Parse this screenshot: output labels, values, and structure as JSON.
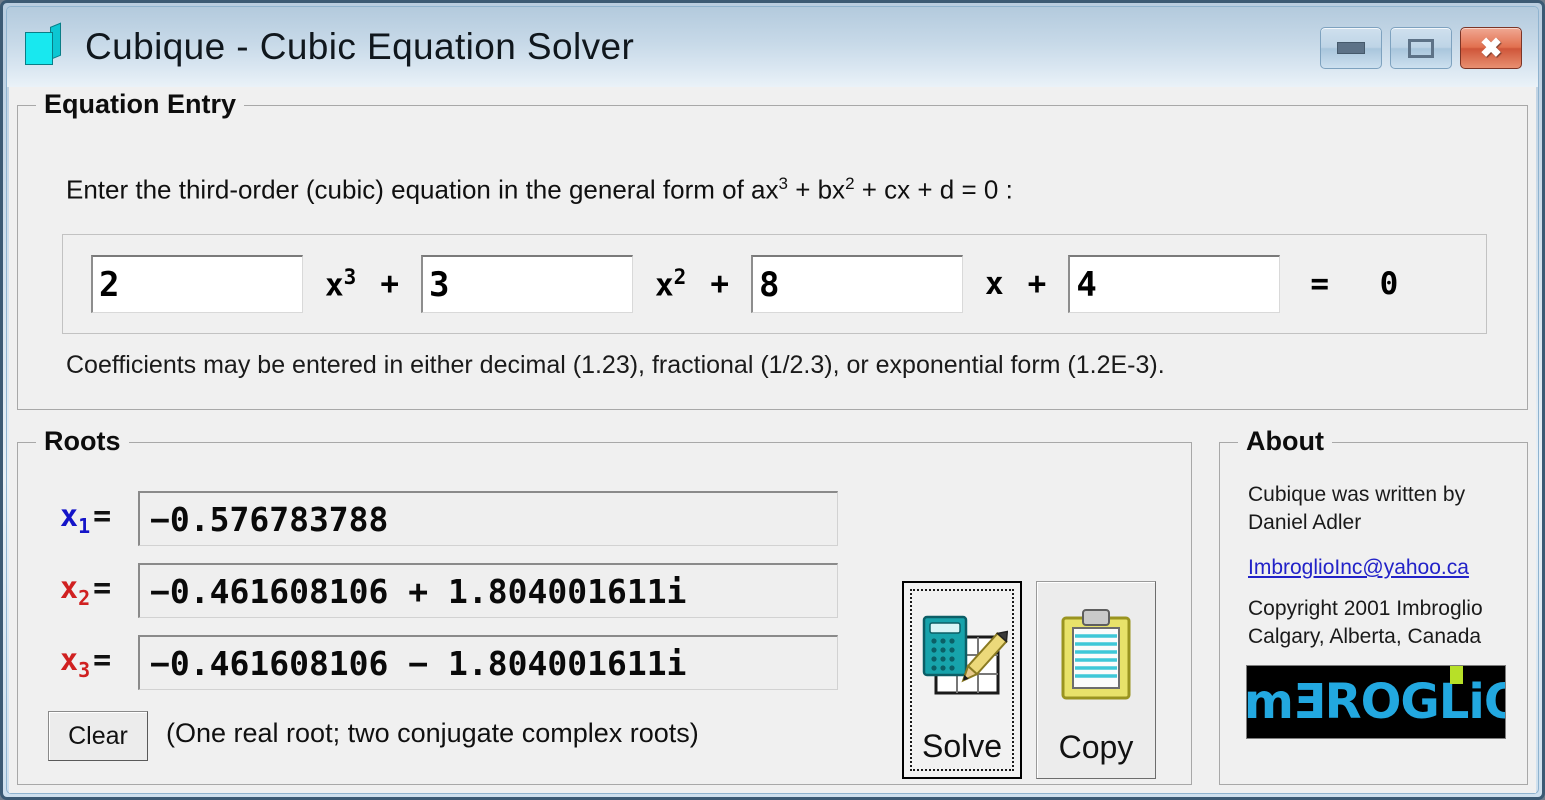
{
  "window": {
    "title": "Cubique - Cubic Equation Solver",
    "icon": "cube-icon",
    "controls": {
      "minimize": "minimize-icon",
      "maximize": "maximize-icon",
      "close": "✖"
    }
  },
  "equation_entry": {
    "group_title": "Equation Entry",
    "instruction_before": "Enter the third-order (cubic) equation in the general form of ax",
    "instruction_sup1": "3",
    "instruction_mid1": " + bx",
    "instruction_sup2": "2",
    "instruction_mid2": " + cx + d = 0 :",
    "coefficients": [
      {
        "name": "a",
        "value": "2",
        "term": "x",
        "exponent": "3",
        "operator": "+"
      },
      {
        "name": "b",
        "value": "3",
        "term": "x",
        "exponent": "2",
        "operator": "+"
      },
      {
        "name": "c",
        "value": "8",
        "term": "x",
        "exponent": "",
        "operator": "+"
      },
      {
        "name": "d",
        "value": "4",
        "term": "",
        "exponent": "",
        "operator": ""
      }
    ],
    "equals": "=  0",
    "hint": "Coefficients may be entered in either decimal (1.23), fractional (1/2.3), or exponential form (1.2E-3)."
  },
  "roots": {
    "group_title": "Roots",
    "items": [
      {
        "label": "x",
        "subscript": "1",
        "equals": "=",
        "value": "−0.576783788",
        "color": "#1414c8"
      },
      {
        "label": "x",
        "subscript": "2",
        "equals": "=",
        "value": "−0.461608106  +  1.804001611i",
        "color": "#d02020"
      },
      {
        "label": "x",
        "subscript": "3",
        "equals": "=",
        "value": "−0.461608106  −  1.804001611i",
        "color": "#d02020"
      }
    ],
    "clear_label": "Clear",
    "status": "(One real root; two conjugate complex roots)"
  },
  "actions": {
    "solve_label": "Solve",
    "solve_icon": "calculator-spreadsheet-pencil-icon",
    "copy_label": "Copy",
    "copy_icon": "clipboard-icon"
  },
  "about": {
    "group_title": "About",
    "author_line1": "Cubique was written by",
    "author_line2": "Daniel Adler",
    "email": "ImbroglioInc@yahoo.ca",
    "copyright_line1": "Copyright 2001 Imbroglio",
    "copyright_line2": "Calgary, Alberta, Canada",
    "logo_text": "imƎROGLiO",
    "logo_colors": {
      "text": "#22a8e0",
      "accent": "#b7e028",
      "background": "#000000"
    }
  }
}
